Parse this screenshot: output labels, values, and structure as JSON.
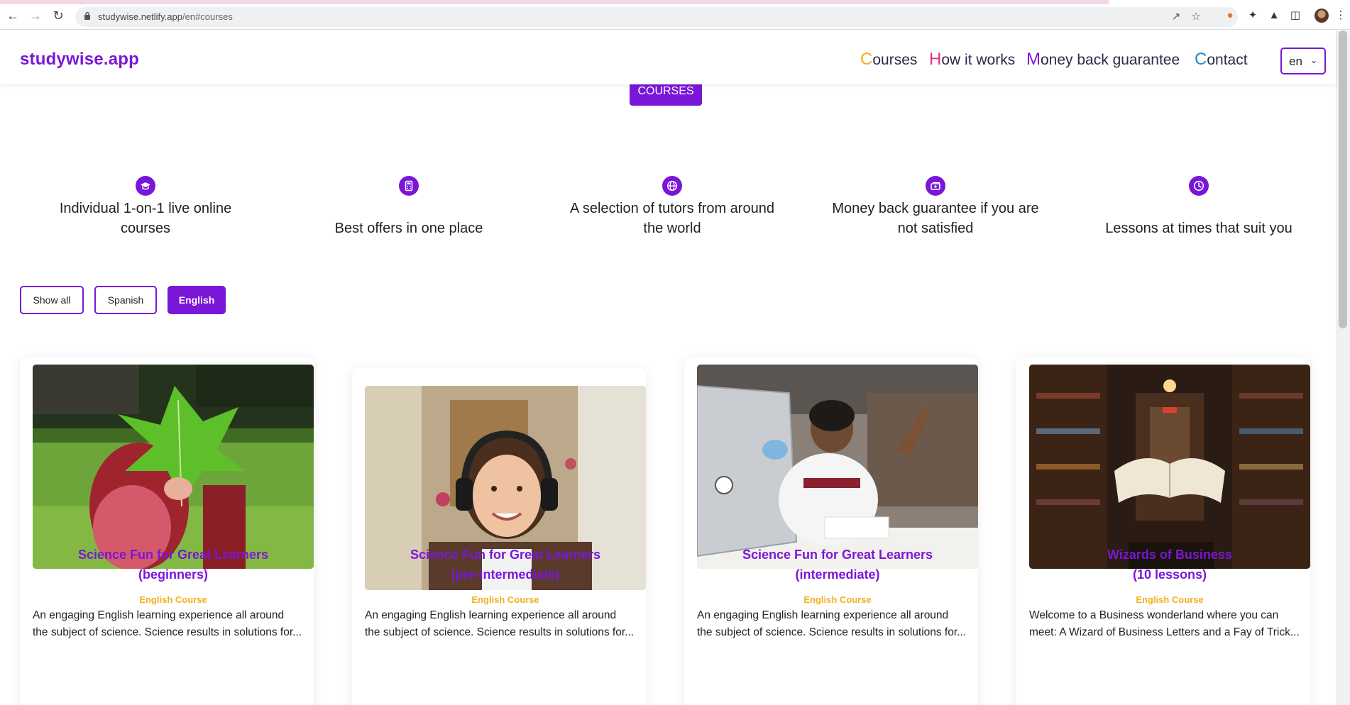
{
  "browser": {
    "url_host": "studywise.netlify.app",
    "url_path": "/en#courses"
  },
  "header": {
    "logo": "studywise.app",
    "nav": [
      {
        "cap": "C",
        "rest": "ourses",
        "color": "#f2b01e"
      },
      {
        "cap": "H",
        "rest": "ow it works",
        "color": "#e0327a"
      },
      {
        "cap": "M",
        "rest": "oney back guarantee",
        "color": "#7a16d8"
      },
      {
        "cap": "C",
        "rest": "ontact",
        "color": "#1f8ad0"
      }
    ],
    "language": "en"
  },
  "section_chip": "COURSES",
  "features": [
    {
      "text": "Individual 1-on-1 live online courses",
      "icon": "graduation-cap-icon"
    },
    {
      "text": "Best offers in one place",
      "icon": "calculator-icon"
    },
    {
      "text": "A selection of tutors from around the world",
      "icon": "globe-icon"
    },
    {
      "text": "Money back guarantee if you are not satisfied",
      "icon": "money-icon"
    },
    {
      "text": "Lessons at times that suit you",
      "icon": "clock-icon"
    }
  ],
  "filters": [
    {
      "label": "Show all",
      "active": false
    },
    {
      "label": "Spanish",
      "active": false
    },
    {
      "label": "English",
      "active": true
    }
  ],
  "courses": [
    {
      "title_line1": "Science Fun for Great Learners",
      "title_line2": "(beginners)",
      "kind": "English Course",
      "desc_line1": "An engaging English learning experience all around",
      "desc_line2": "the subject of science. Science results in solutions for...",
      "photo": "child-holding-green-leaf"
    },
    {
      "title_line1": "Science Fun for Great Learners",
      "title_line2": "(pre-intermediate)",
      "kind": "English Course",
      "desc_line1": "An engaging English learning experience all around",
      "desc_line2": "the subject of science. Science results in solutions for...",
      "photo": "smiling-girl-with-headphones"
    },
    {
      "title_line1": "Science Fun for Great Learners",
      "title_line2": "(intermediate)",
      "kind": "English Course",
      "desc_line1": "An engaging English learning experience all around",
      "desc_line2": "the subject of science. Science results in solutions for...",
      "photo": "boy-at-laptop"
    },
    {
      "title_line1": "Wizards of Business",
      "title_line2": "(10 lessons)",
      "kind": "English Course",
      "desc_line1": "Welcome to a Business wonderland where you can",
      "desc_line2": "meet: A Wizard of Business Letters and a Fay of Trick...",
      "photo": "floating-book-in-library"
    }
  ]
}
